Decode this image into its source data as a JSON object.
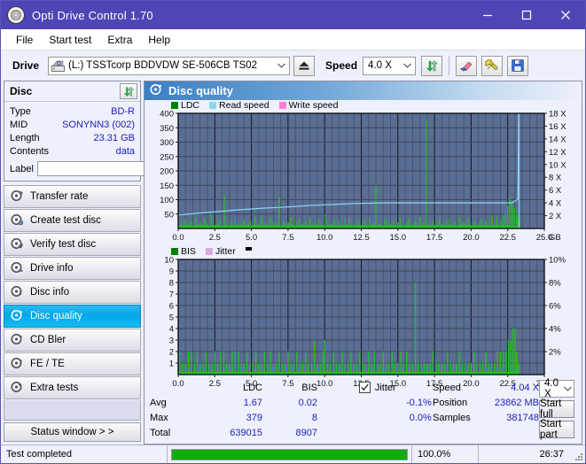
{
  "window": {
    "title": "Opti Drive Control 1.70",
    "app_icon": "disc-icon",
    "minimize": "minimize-icon",
    "maximize": "maximize-icon",
    "close": "close-icon"
  },
  "menu": {
    "items": [
      "File",
      "Start test",
      "Extra",
      "Help"
    ]
  },
  "toolbar": {
    "drive_label": "Drive",
    "drive_value": "(L:)   TSSTcorp BDDVDW SE-506CB TS02",
    "eject_icon": "eject-icon",
    "speed_label": "Speed",
    "speed_value": "4.0 X",
    "refresh_icon": "refresh-icon",
    "erase_icon": "eraser-icon",
    "tools_icon": "tools-icon",
    "save_icon": "save-icon"
  },
  "disc_panel": {
    "title": "Disc",
    "refresh_icon": "refresh-icon",
    "rows": [
      {
        "key": "Type",
        "value": "BD-R"
      },
      {
        "key": "MID",
        "value": "SONYNN3 (002)"
      },
      {
        "key": "Length",
        "value": "23.31 GB"
      },
      {
        "key": "Contents",
        "value": "data"
      }
    ],
    "label_key": "Label",
    "label_value": "",
    "label_placeholder": "",
    "disc_button_icon": "cd-disc-icon"
  },
  "nav": {
    "items": [
      {
        "label": "Transfer rate",
        "icon": "disc-test-icon",
        "active": false
      },
      {
        "label": "Create test disc",
        "icon": "disc-test-icon",
        "active": false
      },
      {
        "label": "Verify test disc",
        "icon": "disc-test-icon",
        "active": false
      },
      {
        "label": "Drive info",
        "icon": "disc-test-icon",
        "active": false
      },
      {
        "label": "Disc info",
        "icon": "disc-test-icon",
        "active": false
      },
      {
        "label": "Disc quality",
        "icon": "disc-test-icon",
        "active": true
      },
      {
        "label": "CD Bler",
        "icon": "disc-test-icon",
        "active": false
      },
      {
        "label": "FE / TE",
        "icon": "disc-test-icon",
        "active": false
      },
      {
        "label": "Extra tests",
        "icon": "disc-test-icon",
        "active": false
      }
    ],
    "status_window_button": "Status window > >"
  },
  "panel": {
    "title": "Disc quality",
    "icon": "disc-quality-icon"
  },
  "stats": {
    "col_headers": [
      "LDC",
      "BIS"
    ],
    "row_labels": [
      "Avg",
      "Max",
      "Total"
    ],
    "ldc": {
      "avg": "1.67",
      "max": "379",
      "total": "639015"
    },
    "bis": {
      "avg": "0.02",
      "max": "8",
      "total": "8907"
    },
    "jitter": {
      "label": "Jitter",
      "checked": true,
      "avg": "-0.1%",
      "max": "0.0%"
    },
    "speed_label": "Speed",
    "speed_value": "4.04 X",
    "position_label": "Position",
    "position_value": "23862 MB",
    "samples_label": "Samples",
    "samples_value": "381748",
    "speed_select": "4.0 X",
    "start_full_button": "Start full",
    "start_part_button": "Start part"
  },
  "statusbar": {
    "message": "Test completed",
    "progress_percent_text": "100.0%",
    "progress_percent": 100,
    "elapsed": "26:37"
  },
  "chart_data": [
    {
      "type": "area",
      "name": "ldc-chart",
      "title": "",
      "xlabel": "GB",
      "ylabel": "",
      "xlim": [
        0,
        25
      ],
      "ylim": [
        0,
        400
      ],
      "y2lim": [
        0,
        18
      ],
      "y2label": "X",
      "grid": true,
      "legend": [
        {
          "name": "LDC",
          "color": "#008000"
        },
        {
          "name": "Read speed",
          "color": "#89d8f2"
        },
        {
          "name": "Write speed",
          "color": "#ff7fd4"
        }
      ],
      "xticks": [
        "0.0",
        "2.5",
        "5.0",
        "7.5",
        "10.0",
        "12.5",
        "15.0",
        "17.5",
        "20.0",
        "22.5",
        "25.0"
      ],
      "yticks": [
        400,
        350,
        300,
        250,
        200,
        150,
        100,
        50
      ],
      "y2ticks": [
        "18 X",
        "16 X",
        "14 X",
        "12 X",
        "10 X",
        "8 X",
        "6 X",
        "4 X",
        "2 X"
      ],
      "series": [
        {
          "name": "LDC",
          "color": "#22c322",
          "kind": "impulse",
          "x": [
            0.05,
            0.2,
            0.35,
            0.5,
            0.6,
            0.75,
            0.9,
            1.05,
            1.2,
            1.35,
            1.5,
            1.65,
            1.8,
            1.95,
            2.1,
            2.25,
            2.4,
            2.55,
            2.7,
            2.85,
            3.0,
            3.15,
            3.3,
            3.45,
            3.6,
            3.75,
            3.9,
            4.05,
            4.2,
            4.35,
            4.5,
            4.65,
            4.8,
            4.95,
            5.1,
            5.25,
            5.4,
            5.55,
            5.7,
            5.85,
            6.0,
            6.15,
            6.3,
            6.45,
            6.6,
            6.75,
            6.9,
            7.05,
            7.2,
            7.35,
            7.5,
            7.65,
            7.8,
            7.95,
            8.1,
            8.25,
            8.4,
            8.55,
            8.7,
            8.85,
            9.0,
            9.15,
            9.3,
            9.45,
            9.6,
            9.75,
            9.9,
            10.05,
            10.2,
            10.35,
            10.5,
            10.65,
            10.8,
            10.95,
            11.1,
            11.25,
            11.4,
            11.55,
            11.7,
            11.85,
            12.0,
            12.15,
            12.3,
            12.45,
            12.6,
            12.75,
            12.9,
            13.05,
            13.2,
            13.35,
            13.5,
            13.65,
            13.8,
            13.95,
            14.1,
            14.25,
            14.4,
            14.55,
            14.7,
            14.85,
            15.0,
            15.15,
            15.3,
            15.45,
            15.6,
            15.75,
            15.9,
            16.05,
            16.2,
            16.35,
            16.5,
            16.65,
            16.8,
            16.95,
            17.1,
            17.25,
            17.4,
            17.55,
            17.7,
            17.85,
            18.0,
            18.15,
            18.3,
            18.45,
            18.6,
            18.75,
            18.9,
            19.05,
            19.2,
            19.35,
            19.5,
            19.65,
            19.8,
            19.95,
            20.1,
            20.25,
            20.4,
            20.55,
            20.7,
            20.85,
            21.0,
            21.15,
            21.3,
            21.45,
            21.6,
            21.75,
            21.9,
            22.05,
            22.2,
            22.35,
            22.5,
            22.65,
            22.8,
            22.95,
            23.1,
            23.2,
            23.3
          ],
          "y": [
            10,
            22,
            12,
            30,
            14,
            18,
            26,
            12,
            40,
            16,
            20,
            14,
            34,
            18,
            12,
            50,
            22,
            14,
            18,
            30,
            10,
            115,
            18,
            12,
            26,
            14,
            38,
            16,
            12,
            22,
            30,
            14,
            18,
            26,
            12,
            40,
            16,
            20,
            46,
            14,
            18,
            12,
            34,
            22,
            14,
            18,
            110,
            12,
            26,
            14,
            20,
            38,
            16,
            12,
            22,
            30,
            14,
            18,
            26,
            12,
            40,
            16,
            20,
            14,
            34,
            18,
            12,
            50,
            22,
            14,
            18,
            30,
            10,
            26,
            18,
            12,
            40,
            14,
            38,
            16,
            12,
            22,
            30,
            14,
            18,
            26,
            12,
            40,
            16,
            20,
            150,
            14,
            18,
            12,
            34,
            22,
            14,
            18,
            26,
            12,
            20,
            38,
            16,
            12,
            22,
            30,
            14,
            18,
            26,
            12,
            40,
            16,
            20,
            380,
            18,
            12,
            26,
            14,
            20,
            38,
            16,
            12,
            22,
            30,
            14,
            18,
            26,
            12,
            40,
            16,
            20,
            14,
            34,
            18,
            12,
            22,
            14,
            18,
            30,
            10,
            26,
            18,
            12,
            40,
            14,
            38,
            16,
            30,
            45,
            60,
            80,
            110,
            95,
            70,
            50,
            35,
            20
          ]
        },
        {
          "name": "Read speed",
          "color": "#89d8f2",
          "kind": "line",
          "x": [
            0.0,
            1.0,
            2.0,
            3.0,
            4.0,
            5.0,
            6.0,
            7.0,
            8.0,
            9.0,
            10.0,
            11.0,
            12.0,
            13.0,
            14.0,
            15.0,
            16.0,
            17.0,
            18.0,
            19.0,
            20.0,
            21.0,
            22.0,
            22.8,
            23.2,
            23.25
          ],
          "y_speed_x": [
            2.1,
            2.3,
            2.5,
            2.7,
            2.9,
            3.05,
            3.2,
            3.3,
            3.45,
            3.6,
            3.7,
            3.8,
            3.9,
            3.95,
            4.0,
            4.0,
            4.0,
            4.0,
            4.0,
            4.0,
            4.0,
            4.0,
            4.0,
            4.0,
            4.6,
            18.0
          ]
        }
      ]
    },
    {
      "type": "area",
      "name": "bis-chart",
      "title": "",
      "xlabel": "GB",
      "ylabel": "",
      "xlim": [
        0,
        25
      ],
      "ylim": [
        0,
        10
      ],
      "y2lim": [
        0,
        10
      ],
      "y2label": "%",
      "grid": true,
      "legend": [
        {
          "name": "BIS",
          "color": "#008000"
        },
        {
          "name": "Jitter",
          "color": "#d9a8e0"
        }
      ],
      "xticks": [
        "0.0",
        "2.5",
        "5.0",
        "7.5",
        "10.0",
        "12.5",
        "15.0",
        "17.5",
        "20.0",
        "22.5",
        "25.0"
      ],
      "yticks": [
        10,
        9,
        8,
        7,
        6,
        5,
        4,
        3,
        2,
        1
      ],
      "y2ticks": [
        "10%",
        "8%",
        "6%",
        "4%",
        "2%"
      ],
      "series": [
        {
          "name": "BIS",
          "color": "#22c322",
          "kind": "impulse",
          "x": [
            0.1,
            0.3,
            0.5,
            0.7,
            0.9,
            1.1,
            1.3,
            1.5,
            1.7,
            1.9,
            2.1,
            2.3,
            2.5,
            2.7,
            2.9,
            3.1,
            3.3,
            3.5,
            3.7,
            3.9,
            4.1,
            4.3,
            4.5,
            4.7,
            4.9,
            5.1,
            5.3,
            5.5,
            5.7,
            5.9,
            6.1,
            6.3,
            6.5,
            6.7,
            6.9,
            7.1,
            7.3,
            7.5,
            7.7,
            7.9,
            8.1,
            8.3,
            8.5,
            8.7,
            8.9,
            9.1,
            9.3,
            9.5,
            9.7,
            9.9,
            10.0,
            10.2,
            10.4,
            10.6,
            10.8,
            11.0,
            11.2,
            11.4,
            11.6,
            11.8,
            12.0,
            12.2,
            12.4,
            12.6,
            12.8,
            13.0,
            13.2,
            13.4,
            13.6,
            13.8,
            14.0,
            14.2,
            14.4,
            14.6,
            14.8,
            15.0,
            15.2,
            15.4,
            15.6,
            15.8,
            16.0,
            16.2,
            16.4,
            16.6,
            16.8,
            17.0,
            17.2,
            17.4,
            17.6,
            17.8,
            18.0,
            18.2,
            18.4,
            18.6,
            18.8,
            19.0,
            19.2,
            19.4,
            19.6,
            19.8,
            20.0,
            20.2,
            20.4,
            20.6,
            20.8,
            21.0,
            21.2,
            21.4,
            21.6,
            21.8,
            22.0,
            22.2,
            22.4,
            22.55,
            22.7,
            22.85,
            23.0,
            23.1,
            23.2,
            23.25
          ],
          "y": [
            2,
            1,
            1,
            2,
            2,
            1,
            2,
            1,
            1,
            2,
            1,
            1,
            2,
            1,
            2,
            2,
            1,
            1,
            2,
            2,
            2,
            1,
            1,
            2,
            1,
            1,
            2,
            1,
            1,
            2,
            1,
            2,
            1,
            1,
            2,
            1,
            1,
            2,
            1,
            1,
            2,
            1,
            1,
            2,
            1,
            1,
            3,
            1,
            1,
            2,
            3,
            1,
            1,
            2,
            1,
            1,
            2,
            1,
            1,
            2,
            1,
            1,
            2,
            1,
            1,
            2,
            1,
            2,
            1,
            1,
            2,
            1,
            1,
            2,
            1,
            1,
            2,
            1,
            2,
            1,
            1,
            8,
            1,
            1,
            1,
            1,
            1,
            2,
            1,
            1,
            1,
            1,
            2,
            1,
            1,
            1,
            2,
            1,
            1,
            1,
            1,
            2,
            1,
            1,
            1,
            2,
            1,
            1,
            1,
            2,
            2,
            2,
            2,
            3,
            3,
            4,
            4,
            2,
            1,
            1
          ]
        }
      ]
    }
  ]
}
